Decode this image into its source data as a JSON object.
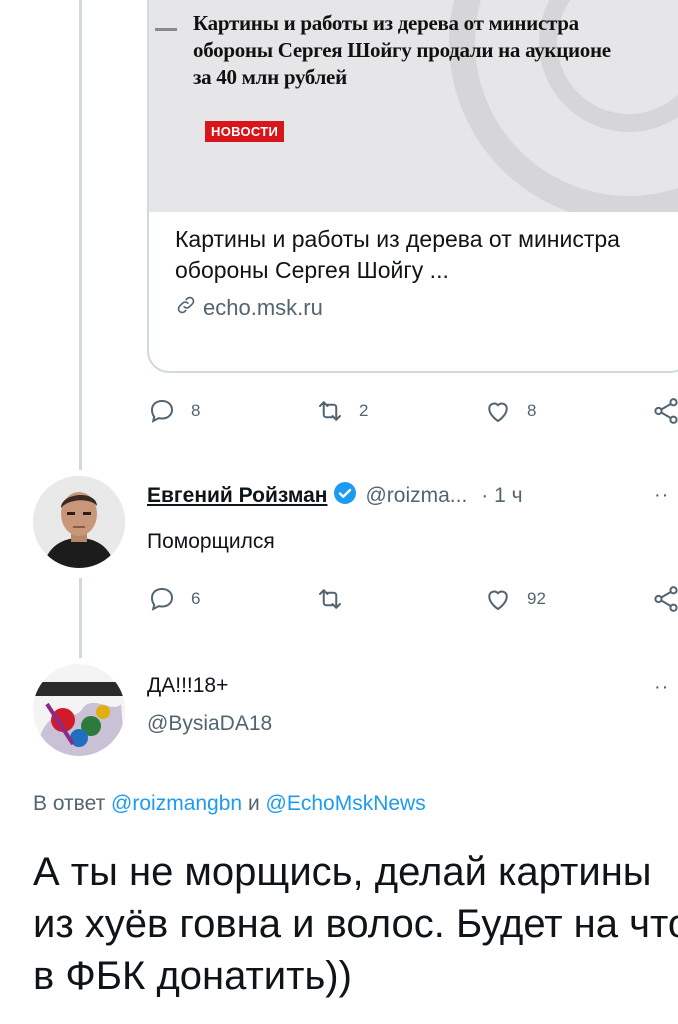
{
  "card": {
    "headline": "Картины и работы из дерева от министра обороны Сергея Шойгу продали на аукционе за 40 млн рублей",
    "badge": "НОВОСТИ",
    "title": "Картины и работы из дерева от министра обороны Сергея Шойгу ...",
    "domain": "echo.msk.ru",
    "domain_icon": "link-icon"
  },
  "tweet1_actions": {
    "replies": "8",
    "retweets": "2",
    "likes": "8"
  },
  "tweet2": {
    "name": "Евгений Ройзман",
    "verified": true,
    "handle": "@roizma...",
    "time": "· 1 ч",
    "text": "Поморщился",
    "replies": "6",
    "retweets": "",
    "likes": "92"
  },
  "tweet3": {
    "name": "ДА!!!18+",
    "handle": "@BysiaDA18",
    "reply_prefix": "В ответ",
    "reply_user1": "@roizmangbn",
    "reply_and": "и",
    "reply_user2": "@EchoMskNews",
    "text": "А ты не морщись, делай картины из хуёв говна и волос. Будет на что в ФБК донатить))"
  },
  "colors": {
    "accent": "#1d9bf0",
    "muted": "#536471",
    "badge": "#d8151b"
  }
}
